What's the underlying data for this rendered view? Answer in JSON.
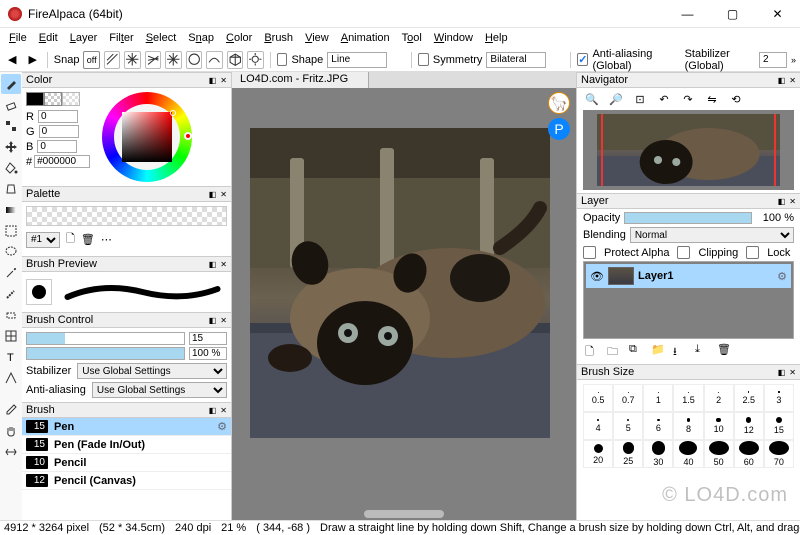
{
  "window": {
    "title": "FireAlpaca (64bit)"
  },
  "menu": [
    "File",
    "Edit",
    "Layer",
    "Filter",
    "Select",
    "Snap",
    "Color",
    "Brush",
    "View",
    "Animation",
    "Tool",
    "Window",
    "Help"
  ],
  "toolbar": {
    "snap_label": "Snap",
    "snap_off": "off",
    "shape_label": "Shape",
    "shape_value": "Line",
    "symmetry_label": "Symmetry",
    "symmetry_value": "Bilateral",
    "aa_label": "Anti-aliasing (Global)",
    "stabilizer_label": "Stabilizer (Global)",
    "stabilizer_value": "2"
  },
  "panels": {
    "color": {
      "title": "Color",
      "r": "0",
      "g": "0",
      "b": "0",
      "hex": "#000000"
    },
    "palette": {
      "title": "Palette",
      "selected": "#1"
    },
    "brush_preview": {
      "title": "Brush Preview"
    },
    "brush_control": {
      "title": "Brush Control",
      "size_value": "15",
      "opacity_value": "100 %",
      "stabilizer_label": "Stabilizer",
      "stabilizer_value": "Use Global Settings",
      "aa_label": "Anti-aliasing",
      "aa_value": "Use Global Settings"
    },
    "brush": {
      "title": "Brush",
      "items": [
        {
          "size": "15",
          "name": "Pen",
          "selected": true
        },
        {
          "size": "15",
          "name": "Pen (Fade In/Out)"
        },
        {
          "size": "10",
          "name": "Pencil"
        },
        {
          "size": "12",
          "name": "Pencil (Canvas)"
        }
      ]
    },
    "navigator": {
      "title": "Navigator"
    },
    "layer": {
      "title": "Layer",
      "opacity_label": "Opacity",
      "opacity_value": "100 %",
      "blending_label": "Blending",
      "blending_value": "Normal",
      "protect_alpha": "Protect Alpha",
      "clipping": "Clipping",
      "lock": "Lock",
      "layer_name": "Layer1"
    },
    "brush_size": {
      "title": "Brush Size",
      "sizes": [
        0.5,
        0.7,
        1,
        1.5,
        2,
        2.5,
        3,
        4,
        5,
        6,
        8,
        10,
        12,
        15,
        20,
        25,
        30,
        40,
        50,
        60,
        70
      ]
    }
  },
  "document": {
    "tab_title": "LO4D.com - Fritz.JPG"
  },
  "status": {
    "dims": "4912 * 3264 pixel",
    "cm": "(52 * 34.5cm)",
    "dpi": "240 dpi",
    "zoom": "21 %",
    "coords": "( 344, -68 )",
    "hint": "Draw a straight line by holding down Shift, Change a brush size by holding down Ctrl, Alt, and dragging"
  },
  "watermark": "© LO4D.com"
}
